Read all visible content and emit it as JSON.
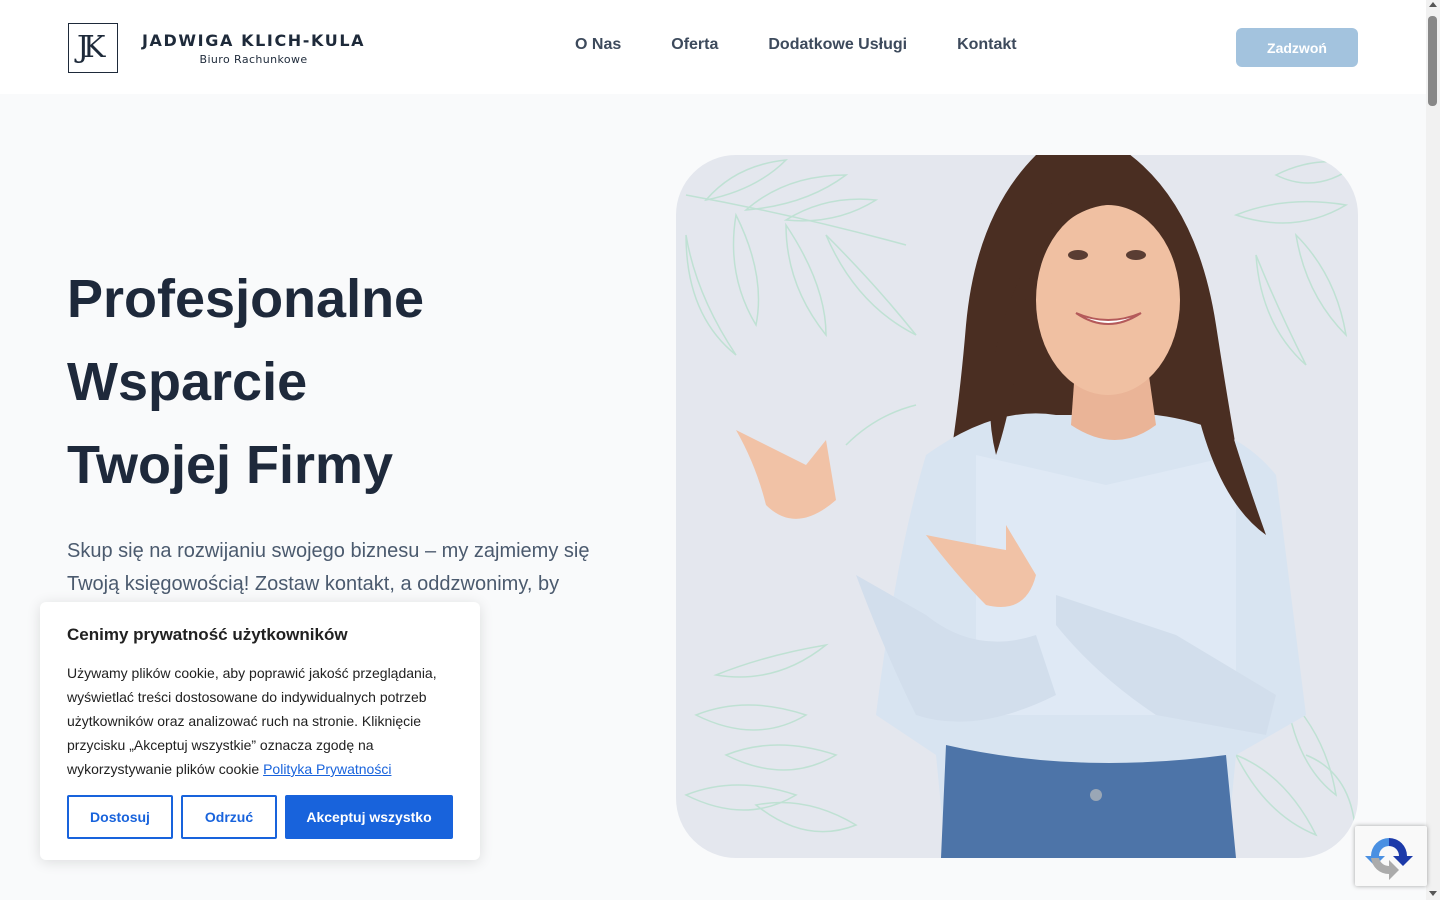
{
  "header": {
    "logo_mark": "JK",
    "logo_title": "JADWIGA KLICH-KULA",
    "logo_subtitle": "Biuro Rachunkowe",
    "nav": [
      "O Nas",
      "Oferta",
      "Dodatkowe Usługi",
      "Kontakt"
    ],
    "call_button": "Zadzwoń"
  },
  "hero": {
    "title_lines": [
      "Profesjonalne",
      "Wsparcie",
      "Twojej Firmy"
    ],
    "text": "Skup się na rozwijaniu swojego biznesu – my zajmiemy się Twoją księgowością! Zostaw kontakt, a oddzwonimy, by omówić szczegóły i potrzeby Twojej firmy."
  },
  "cookie": {
    "title": "Cenimy prywatność użytkowników",
    "text": "Używamy plików cookie, aby poprawić jakość przeglądania, wyświetlać treści dostosowane do indywidualnych potrzeb użytkowników oraz analizować ruch na stronie. Kliknięcie przycisku „Akceptuj wszystkie” oznacza zgodę na wykorzystywanie plików cookie",
    "link": "Polityka Prywatności",
    "buttons": {
      "customize": "Dostosuj",
      "reject": "Odrzuć",
      "accept": "Akceptuj wszystko"
    }
  },
  "colors": {
    "brand_dark": "#1e2a3a",
    "call_button": "#a3c3de",
    "cookie_accent": "#1863dc",
    "leaf_green": "#b9e0cf"
  },
  "icons": {
    "recaptcha": "recaptcha-icon"
  }
}
